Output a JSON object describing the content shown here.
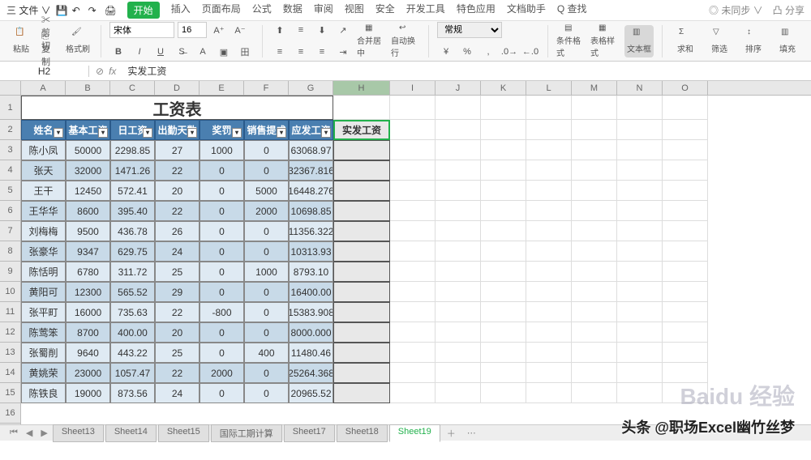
{
  "menu": {
    "file": "三 文件 ∨",
    "tabs": [
      "开始",
      "插入",
      "页面布局",
      "公式",
      "数据",
      "审阅",
      "视图",
      "安全",
      "开发工具",
      "特色应用",
      "文档助手"
    ],
    "search": "Q 查找",
    "right1": "◎ 未同步 ∨",
    "right2": "凸 分享"
  },
  "ribbon": {
    "paste": "粘贴",
    "cut": "✂ 剪切",
    "copy": "⎘ 复制",
    "format_painter": "格式刷",
    "font_name": "宋体",
    "font_size": "16",
    "merge": "合并居中",
    "wrap": "自动换行",
    "number_format": "常规",
    "cond_format": "条件格式",
    "cell_style": "表格样式",
    "sum": "求和",
    "filter": "筛选",
    "sort": "排序",
    "fill": "填充"
  },
  "fbar": {
    "namebox": "H2",
    "formula": "实发工资"
  },
  "columns": [
    "A",
    "B",
    "C",
    "D",
    "E",
    "F",
    "G",
    "H",
    "I",
    "J",
    "K",
    "L",
    "M",
    "N",
    "O"
  ],
  "title": "工资表",
  "headers": [
    "姓名",
    "基本工资",
    "日工资",
    "出勤天数",
    "奖罚",
    "销售提成",
    "应发工资"
  ],
  "h_header": "实发工资",
  "chart_data": {
    "type": "table",
    "columns": [
      "姓名",
      "基本工资",
      "日工资",
      "出勤天数",
      "奖罚",
      "销售提成",
      "应发工资"
    ],
    "rows": [
      [
        "陈小凤",
        "50000",
        "2298.85",
        "27",
        "1000",
        "0",
        "63068.97"
      ],
      [
        "张天",
        "32000",
        "1471.26",
        "22",
        "0",
        "0",
        "32367.816"
      ],
      [
        "王干",
        "12450",
        "572.41",
        "20",
        "0",
        "5000",
        "16448.276"
      ],
      [
        "王华华",
        "8600",
        "395.40",
        "22",
        "0",
        "2000",
        "10698.85"
      ],
      [
        "刘梅梅",
        "9500",
        "436.78",
        "26",
        "0",
        "0",
        "11356.322"
      ],
      [
        "张豪华",
        "9347",
        "629.75",
        "24",
        "0",
        "0",
        "10313.93"
      ],
      [
        "陈恬明",
        "6780",
        "311.72",
        "25",
        "0",
        "1000",
        "8793.10"
      ],
      [
        "黄阳可",
        "12300",
        "565.52",
        "29",
        "0",
        "0",
        "16400.00"
      ],
      [
        "张平町",
        "16000",
        "735.63",
        "22",
        "-800",
        "0",
        "15383.908"
      ],
      [
        "陈莺笨",
        "8700",
        "400.00",
        "20",
        "0",
        "0",
        "8000.000"
      ],
      [
        "张蜀削",
        "9640",
        "443.22",
        "25",
        "0",
        "400",
        "11480.46"
      ],
      [
        "黄姚荣",
        "23000",
        "1057.47",
        "22",
        "2000",
        "0",
        "25264.368"
      ],
      [
        "陈铁良",
        "19000",
        "873.56",
        "24",
        "0",
        "0",
        "20965.52"
      ]
    ]
  },
  "sheets": [
    "Sheet13",
    "Sheet14",
    "Sheet15",
    "国际工期计算",
    "Sheet17",
    "Sheet18",
    "Sheet19"
  ],
  "active_sheet": "Sheet19",
  "watermark": "Baidu 经验",
  "credit": "头条 @职场Excel幽竹丝梦"
}
